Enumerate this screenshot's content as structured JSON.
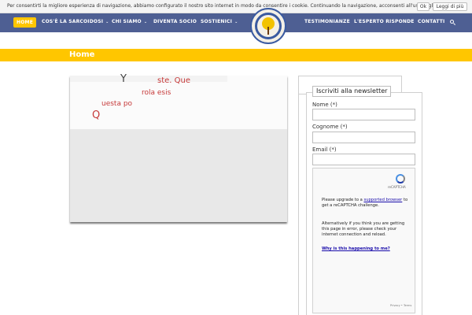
{
  "cookie_bar": {
    "message": "Per consentirti la migliore esperienza di navigazione, abbiamo configurato il nostro sito internet in modo da consentire i cookie. Continuando la navigazione, acconsenti all'uso degli stessi.",
    "ok_label": "Ok",
    "more_label": "Leggi di più"
  },
  "nav": {
    "items": [
      {
        "label": "HOME",
        "active": true
      },
      {
        "label": "COS'È LA SARCOIDOSI",
        "has_dropdown": true
      },
      {
        "label": "CHI SIAMO",
        "has_dropdown": true
      },
      {
        "label": "DIVENTA SOCIO"
      },
      {
        "label": "SOSTIENICI",
        "has_dropdown": true
      },
      {
        "label": "TESTIMONIANZE"
      },
      {
        "label": "L'ESPERTO RISPONDE"
      },
      {
        "label": "CONTATTI"
      }
    ],
    "search_icon": "search-icon",
    "caret_glyph": "⌄"
  },
  "title_bar": {
    "title": "Home"
  },
  "hero": {
    "lines": [
      "Y",
      "ste. Que",
      "rola esis",
      "uesta po",
      "Q"
    ]
  },
  "newsletter": {
    "title": "Iscriviti alla newsletter",
    "fields": [
      {
        "label": "Nome (*)",
        "value": ""
      },
      {
        "label": "Cognome (*)",
        "value": ""
      },
      {
        "label": "Email (*)",
        "value": ""
      }
    ]
  },
  "recaptcha": {
    "brand": "reCAPTCHA",
    "upgrade_before": "Please upgrade to a ",
    "upgrade_link": "supported browser",
    "upgrade_after": " to get a reCAPTCHA challenge.",
    "error_text": "Alternatively if you think you are getting this page in error, please check your internet connection and reload.",
    "why_link": "Why is this happening to me?",
    "footer": "Privacy • Terms"
  },
  "colors": {
    "nav_bg": "#4e5f93",
    "accent": "#ffc600",
    "hero_text": "#c63a3a"
  }
}
